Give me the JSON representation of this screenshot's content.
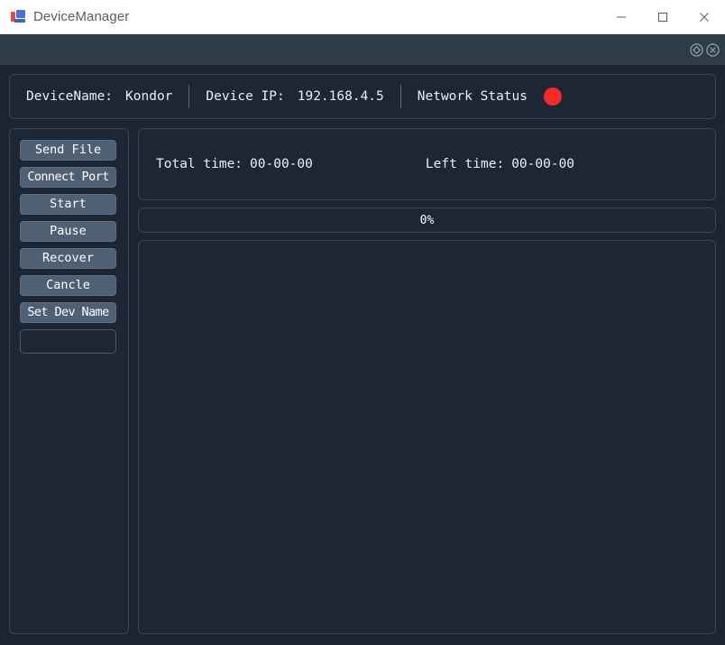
{
  "window": {
    "title": "DeviceManager",
    "icon": "app-logo-icon",
    "controls": [
      {
        "name": "minimize-button",
        "glyph": "minimize"
      },
      {
        "name": "maximize-button",
        "glyph": "maximize"
      },
      {
        "name": "close-button",
        "glyph": "close"
      }
    ]
  },
  "toolstrip": {
    "icons": [
      {
        "name": "settings-circle-icon"
      },
      {
        "name": "close-circle-icon"
      }
    ]
  },
  "device_bar": {
    "name_label": "DeviceName:",
    "name_value": "Kondor",
    "ip_label": "Device IP:",
    "ip_value": "192.168.4.5",
    "network_label": "Network Status",
    "network_state_color": "#f62a2a"
  },
  "buttons": [
    {
      "name": "send-file-button",
      "label": "Send File"
    },
    {
      "name": "connect-port-button",
      "label": "Connect Port"
    },
    {
      "name": "start-button",
      "label": "Start"
    },
    {
      "name": "pause-button",
      "label": "Pause"
    },
    {
      "name": "recover-button",
      "label": "Recover"
    },
    {
      "name": "cancle-button",
      "label": "Cancle"
    },
    {
      "name": "set-dev-name-button",
      "label": "Set Dev Name"
    }
  ],
  "dev_name_input": {
    "value": "",
    "placeholder": ""
  },
  "time_panel": {
    "total_label": "Total time:",
    "total_value": "00-00-00",
    "left_label": "Left time:",
    "left_value": "00-00-00"
  },
  "progress": {
    "percent_text": "0%",
    "percent_value": 0
  },
  "log": {
    "content": ""
  },
  "theme": {
    "window_bg": "#1b2430",
    "panel_bg": "#1d2635",
    "panel_border": "#3a4654",
    "toolstrip_bg": "#2f3b47",
    "button_bg": "#4f6075",
    "text": "#eceff4",
    "accent_red": "#f62a2a"
  }
}
